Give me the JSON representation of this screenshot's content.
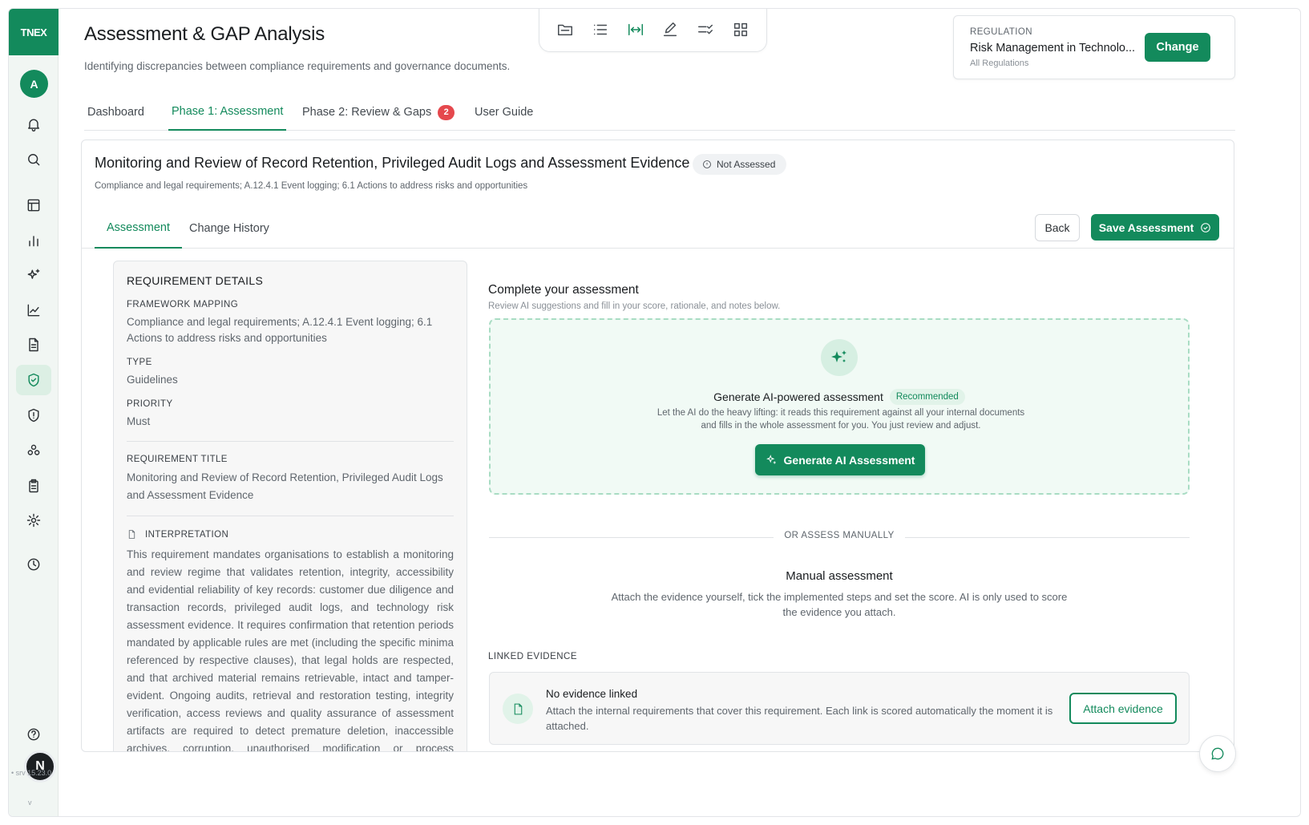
{
  "sidebar": {
    "logo": "TNEX",
    "avatar_initial": "A",
    "user_initial": "N",
    "version_short": "v",
    "version": "• srv 15.23.0",
    "items": [
      {
        "icon": "bell-icon"
      },
      {
        "icon": "search-icon"
      },
      {
        "icon": "table-icon"
      },
      {
        "icon": "bar-chart-icon"
      },
      {
        "icon": "sparkles-icon"
      },
      {
        "icon": "line-chart-icon"
      },
      {
        "icon": "document-icon"
      },
      {
        "icon": "shield-check-icon",
        "active": true
      },
      {
        "icon": "shield-alert-icon"
      },
      {
        "icon": "cluster-icon"
      },
      {
        "icon": "clipboard-icon"
      },
      {
        "icon": "gear-icon"
      },
      {
        "icon": "clock-icon"
      },
      {
        "icon": "help-icon"
      }
    ]
  },
  "header": {
    "title": "Assessment & GAP Analysis",
    "subtitle": "Identifying discrepancies between compliance requirements and governance documents."
  },
  "toolbar": {
    "tools": [
      "folder-icon",
      "list-icon",
      "fit-width-icon",
      "edit-icon",
      "checklist-icon",
      "grid-icon"
    ],
    "active": "fit-width-icon"
  },
  "regulation": {
    "label": "REGULATION",
    "name": "Risk Management in Technolo...",
    "sub": "All Regulations",
    "change_label": "Change"
  },
  "main_tabs": [
    {
      "label": "Dashboard"
    },
    {
      "label": "Phase 1: Assessment",
      "active": true
    },
    {
      "label": "Phase 2: Review & Gaps",
      "badge": "2"
    },
    {
      "label": "User Guide"
    }
  ],
  "requirement": {
    "title": "Monitoring and Review of Record Retention, Privileged Audit Logs and Assessment Evidence",
    "status": "Not Assessed",
    "subtitle": "Compliance and legal requirements; A.12.4.1 Event logging; 6.1 Actions to address risks and opportunities"
  },
  "sub_tabs": [
    {
      "label": "Assessment",
      "active": true
    },
    {
      "label": "Change History"
    }
  ],
  "actions": {
    "back_label": "Back",
    "save_label": "Save Assessment"
  },
  "details": {
    "heading": "REQUIREMENT DETAILS",
    "framework_label": "FRAMEWORK MAPPING",
    "framework_value": "Compliance and legal requirements; A.12.4.1 Event logging; 6.1 Actions to address risks and opportunities",
    "type_label": "TYPE",
    "type_value": "Guidelines",
    "priority_label": "PRIORITY",
    "priority_value": "Must",
    "req_title_label": "REQUIREMENT TITLE",
    "req_title_value": "Monitoring and Review of Record Retention, Privileged Audit Logs and Assessment Evidence",
    "interpretation_label": "INTERPRETATION",
    "interpretation_value": "This requirement mandates organisations to establish a monitoring and review regime that validates retention, integrity, accessibility and evidential reliability of key records: customer due diligence and transaction records, privileged audit logs, and technology risk assessment evidence. It requires confirmation that retention periods mandated by applicable rules are met (including the specific minima referenced by respective clauses), that legal holds are respected, and that archived material remains retrievable, intact and tamper-evident. Ongoing audits, retrieval and restoration testing, integrity verification, access reviews and quality assurance of assessment artifacts are required to detect premature deletion, inaccessible archives, corruption, unauthorised modification or process degradation, to"
  },
  "assessment": {
    "title": "Complete your assessment",
    "subtitle": "Review AI suggestions and fill in your score, rationale, and notes below.",
    "ai_title": "Generate AI-powered assessment",
    "ai_badge": "Recommended",
    "ai_desc": "Let the AI do the heavy lifting: it reads this requirement against all your internal documents and fills in the whole assessment for you. You just review and adjust.",
    "ai_button": "Generate AI Assessment",
    "or_text": "OR ASSESS MANUALLY",
    "manual_title": "Manual assessment",
    "manual_desc": "Attach the evidence yourself, tick the implemented steps and set the score. AI is only used to score the evidence you attach.",
    "evidence_label": "LINKED EVIDENCE",
    "evidence_title": "No evidence linked",
    "evidence_desc": "Attach the internal requirements that cover this requirement. Each link is scored automatically the moment it is attached.",
    "attach_label": "Attach evidence"
  },
  "colors": {
    "brand": "#138a5c",
    "badge": "#e5484d"
  }
}
